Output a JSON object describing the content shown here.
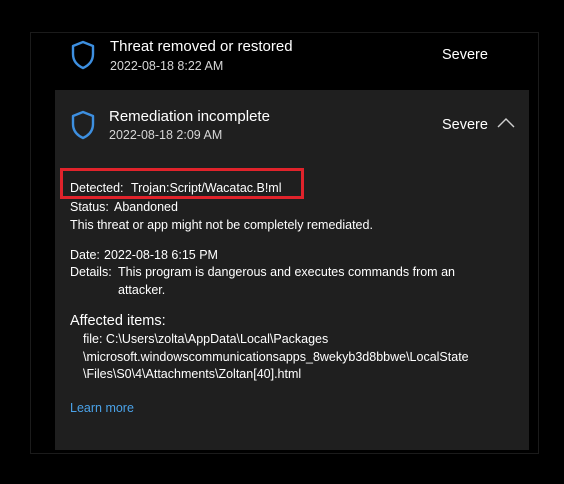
{
  "threats": [
    {
      "title": "Threat removed or restored",
      "date": "2022-08-18 8:22 AM",
      "severity": "Severe",
      "icon": "shield-icon"
    },
    {
      "title": "Remediation incomplete",
      "date": "2022-08-18 2:09 AM",
      "severity": "Severe",
      "icon": "shield-icon",
      "expanded": true
    }
  ],
  "details": {
    "detected_label": "Detected:",
    "detected_value": "Trojan:Script/Wacatac.B!ml",
    "status_label": "Status:",
    "status_value": "Abandoned",
    "status_note": "This threat or app might not be completely remediated.",
    "date_label": "Date:",
    "date_value": "2022-08-18 6:15 PM",
    "details_label": "Details:",
    "details_line1": "This program is dangerous and executes commands from an",
    "details_line2": "attacker.",
    "affected_heading": "Affected items:",
    "file_line1": "file: C:\\Users\\zolta\\AppData\\Local\\Packages",
    "file_line2": "\\microsoft.windowscommunicationsapps_8wekyb3d8bbwe\\LocalState",
    "file_line3": "\\Files\\S0\\4\\Attachments\\Zoltan[40].html",
    "learn_more": "Learn more"
  },
  "colors": {
    "background": "#000000",
    "card": "#1f1f1f",
    "accent_blue": "#4aa2e8",
    "highlight_red": "#e0232b"
  }
}
